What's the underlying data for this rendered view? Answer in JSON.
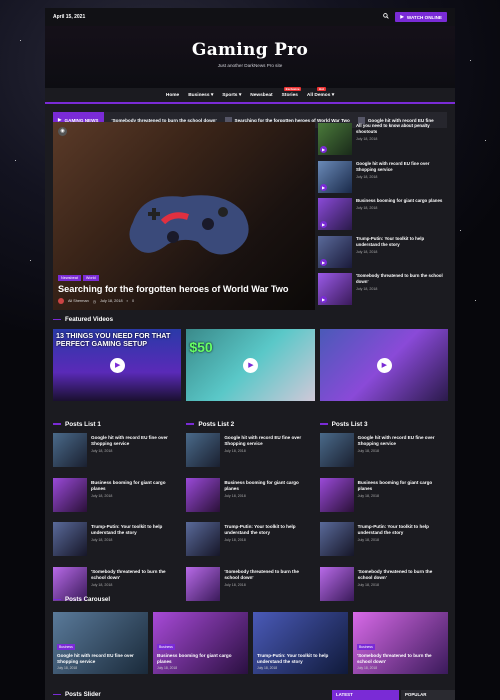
{
  "topbar": {
    "date": "April 15, 2021",
    "watch_label": "WATCH ONLINE"
  },
  "brand": {
    "title": "Gaming Pro",
    "tagline": "Just another DarkNews Pro site"
  },
  "nav": [
    {
      "label": "Home",
      "badge": "",
      "has_caret": false
    },
    {
      "label": "Business",
      "badge": "",
      "has_caret": true
    },
    {
      "label": "Sports",
      "badge": "",
      "has_caret": true
    },
    {
      "label": "Newsbeat",
      "badge": "",
      "has_caret": false
    },
    {
      "label": "Stories",
      "badge": "Exclusive",
      "has_caret": false
    },
    {
      "label": "All Demos",
      "badge": "Hot",
      "has_caret": true
    }
  ],
  "ticker": {
    "label": "GAMING NEWS",
    "items": [
      "'Somebody threatened to burn the school down'",
      "Searching for the forgotten heroes of World War Two",
      "Google hit with record EU fine"
    ]
  },
  "hero": {
    "tags": [
      "Newsbeat",
      "World"
    ],
    "title": "Searching for the forgotten heroes of World War Two",
    "author": "Ali Sherman",
    "date": "July 18, 2018",
    "comments": "0"
  },
  "side_posts": [
    {
      "title": "All you need to know about penalty shootouts",
      "date": "July 18, 2018"
    },
    {
      "title": "Google hit with record EU fine over Shopping service",
      "date": "July 18, 2018"
    },
    {
      "title": "Business booming for giant cargo planes",
      "date": "July 18, 2018"
    },
    {
      "title": "Trump-Putin: Your toolkit to help understand the story",
      "date": "July 18, 2018"
    },
    {
      "title": "'Somebody threatened to burn the school down'",
      "date": "July 18, 2018"
    }
  ],
  "featured": {
    "title": "Featured Videos",
    "videos": [
      {
        "overlay": "13 THINGS YOU NEED FOR THAT PERFECT GAMING SETUP"
      },
      {
        "overlay": "$50"
      },
      {
        "overlay": ""
      }
    ]
  },
  "lists": [
    {
      "title": "Posts List 1"
    },
    {
      "title": "Posts List 2"
    },
    {
      "title": "Posts List 3"
    }
  ],
  "list_posts": [
    {
      "title": "Google hit with record EU fine over Shopping service",
      "date": "July 18, 2018"
    },
    {
      "title": "Business booming for giant cargo planes",
      "date": "July 18, 2018"
    },
    {
      "title": "Trump-Putin: Your toolkit to help understand the story",
      "date": "July 18, 2018"
    },
    {
      "title": "'Somebody threatened to burn the school down'",
      "date": "July 18, 2018"
    }
  ],
  "carousel": {
    "title": "Posts Carousel",
    "items": [
      {
        "tag": "Business",
        "title": "Google hit with record EU fine over Shopping service",
        "date": "July 18, 2018"
      },
      {
        "tag": "Business",
        "title": "Business booming for giant cargo planes",
        "date": "July 18, 2018"
      },
      {
        "tag": "",
        "title": "Trump-Putin: Your toolkit to help understand the story",
        "date": "July 18, 2018"
      },
      {
        "tag": "Business",
        "title": "'Somebody threatened to burn the school down'",
        "date": "July 18, 2018"
      }
    ]
  },
  "slider": {
    "title": "Posts Slider",
    "latest": "LATEST",
    "popular": "POPULAR"
  },
  "colors": {
    "accent": "#7a2bd6",
    "background": "#1b1b20"
  }
}
